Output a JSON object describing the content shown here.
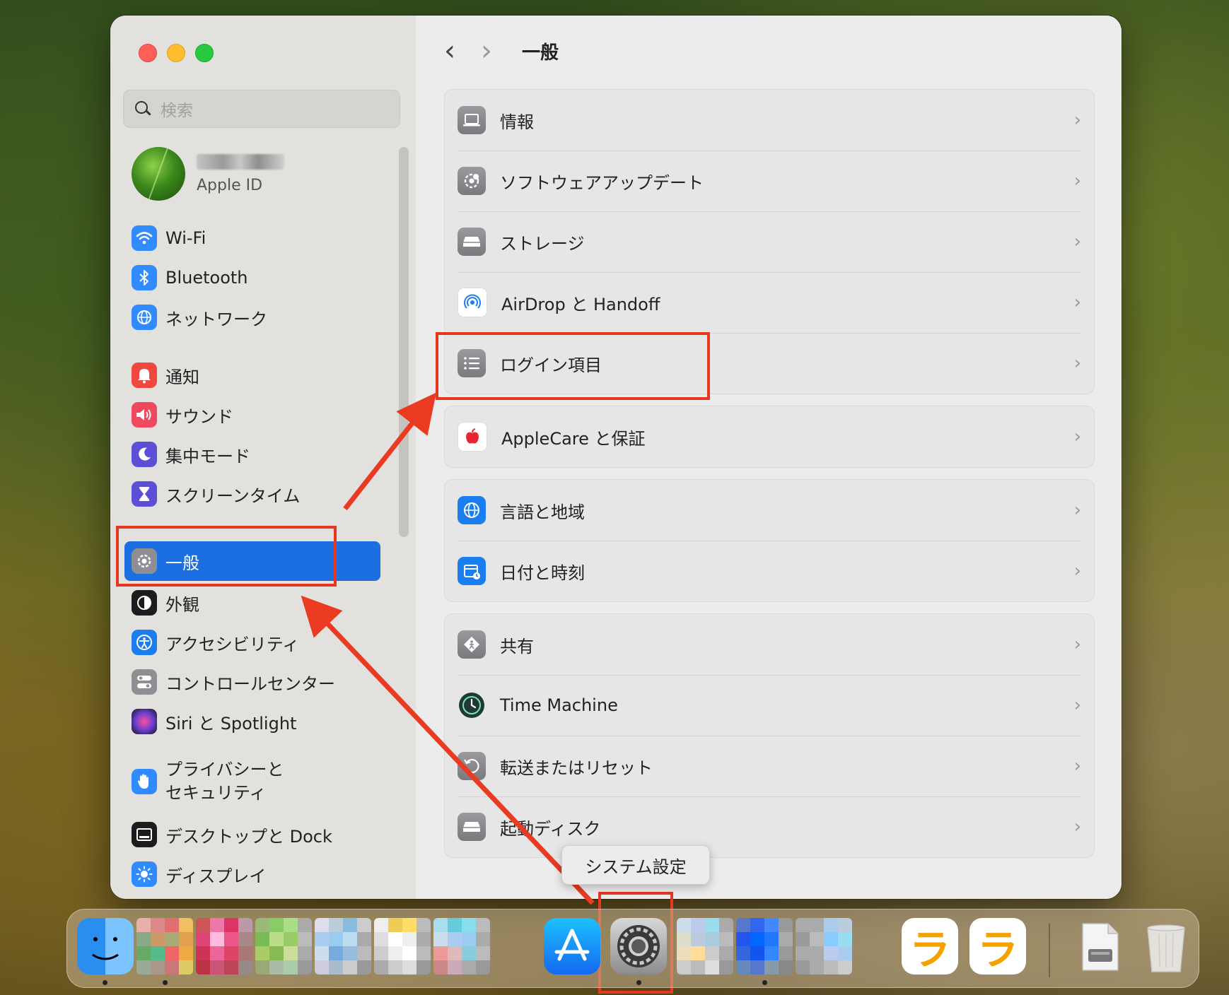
{
  "window": {
    "page_title": "一般",
    "nav_back": "‹",
    "nav_forward": "›"
  },
  "sidebar": {
    "search_placeholder": "検索",
    "apple_id_label": "Apple ID",
    "items": [
      {
        "label": "Wi-Fi",
        "icon": "wifi-icon",
        "color": "#2f8bff"
      },
      {
        "label": "Bluetooth",
        "icon": "bluetooth-icon",
        "color": "#2f8bff"
      },
      {
        "label": "ネットワーク",
        "icon": "globe-icon",
        "color": "#2f8bff"
      },
      {
        "label": "通知",
        "icon": "bell-icon",
        "color": "#f0483e"
      },
      {
        "label": "サウンド",
        "icon": "speaker-icon",
        "color": "#f0485e"
      },
      {
        "label": "集中モード",
        "icon": "moon-icon",
        "color": "#5b4fd8"
      },
      {
        "label": "スクリーンタイム",
        "icon": "hourglass-icon",
        "color": "#5b4fd8"
      },
      {
        "label": "一般",
        "icon": "gear-icon",
        "color": "#8e8e93"
      },
      {
        "label": "外観",
        "icon": "appearance-icon",
        "color": "#1c1c1e"
      },
      {
        "label": "アクセシビリティ",
        "icon": "accessibility-icon",
        "color": "#1b7ef0"
      },
      {
        "label": "コントロールセンター",
        "icon": "toggles-icon",
        "color": "#8e8e93"
      },
      {
        "label": "Siri と Spotlight",
        "icon": "siri-icon",
        "color": "#6a3fd0"
      },
      {
        "label_line1": "プライバシーと",
        "label_line2": "セキュリティ",
        "icon": "hand-icon",
        "color": "#2f8bff"
      },
      {
        "label": "デスクトップと Dock",
        "icon": "dock-icon",
        "color": "#1c1c1e"
      },
      {
        "label": "ディスプレイ",
        "icon": "sun-icon",
        "color": "#2f8bff"
      }
    ]
  },
  "groups": [
    {
      "rows": [
        {
          "label": "情報",
          "icon": "laptop-icon"
        },
        {
          "label": "ソフトウェアアップデート",
          "icon": "gear-badge-icon"
        },
        {
          "label": "ストレージ",
          "icon": "drive-icon"
        },
        {
          "label": "AirDrop と Handoff",
          "icon": "airdrop-icon"
        },
        {
          "label": "ログイン項目",
          "icon": "list-icon"
        }
      ]
    },
    {
      "rows": [
        {
          "label": "AppleCare と保証",
          "icon": "apple-icon"
        }
      ]
    },
    {
      "rows": [
        {
          "label": "言語と地域",
          "icon": "globe-icon"
        },
        {
          "label": "日付と時刻",
          "icon": "calendar-clock-icon"
        }
      ]
    },
    {
      "rows": [
        {
          "label": "共有",
          "icon": "sharing-icon"
        },
        {
          "label": "Time Machine",
          "icon": "time-machine-icon"
        },
        {
          "label": "転送またはリセット",
          "icon": "reset-icon"
        },
        {
          "label": "起動ディスク",
          "icon": "startup-disk-icon"
        }
      ]
    }
  ],
  "chevron": "›",
  "tooltip": "システム設定",
  "dock": {
    "letter_tile": "ラ",
    "items": [
      "finder-icon",
      "app-store-icon",
      "system-settings-icon",
      "trash-icon"
    ]
  },
  "colors": {
    "accent": "#1b6fe0",
    "highlight": "#e8361f"
  }
}
